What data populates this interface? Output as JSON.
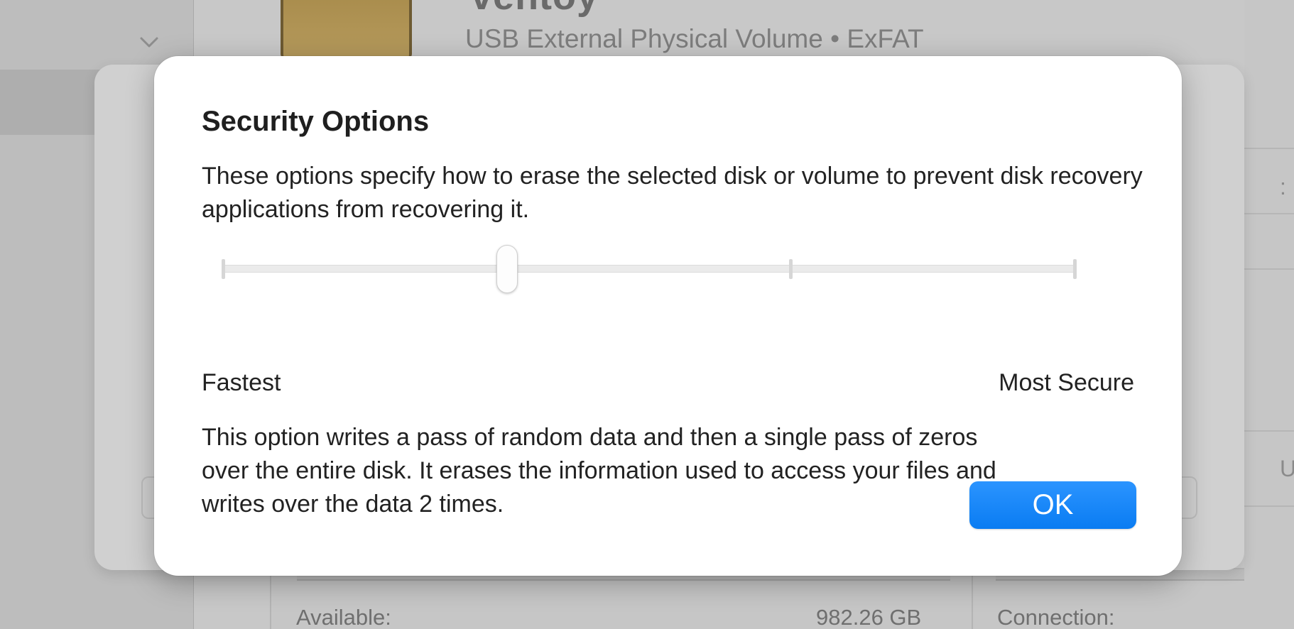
{
  "background": {
    "disk_title": "ventoy",
    "disk_subtitle": "USB External Physical Volume • ExFAT",
    "available_label": "Available:",
    "available_value": "982.26 GB",
    "connection_label": "Connection:",
    "right_partial_u": "U",
    "right_partial_c": ":"
  },
  "dialog": {
    "title": "Security Options",
    "description": "These options specify how to erase the selected disk or volume to prevent disk recovery applications from recovering it.",
    "slider": {
      "min_label": "Fastest",
      "max_label": "Most Secure",
      "positions": 4,
      "selected_index": 1
    },
    "explanation": "This option writes a pass of random data and then a single pass of zeros over the entire disk. It erases the information used to access your files and writes over the data 2 times.",
    "ok_label": "OK",
    "accent_color": "#0a7cf2"
  }
}
